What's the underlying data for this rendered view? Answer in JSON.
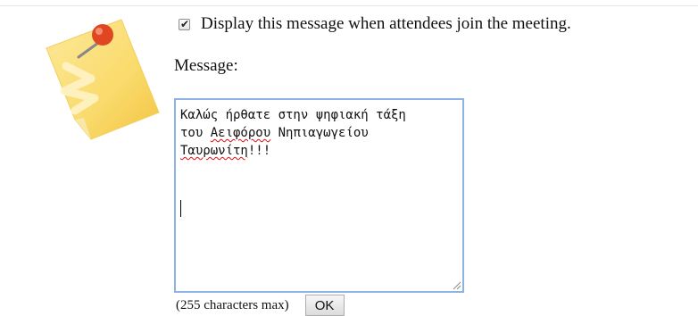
{
  "options": {
    "display_on_join": {
      "checked": true,
      "label": "Display this message when attendees join the meeting."
    }
  },
  "message": {
    "label": "Message:",
    "lines": [
      "Καλώς ήρθατε στην ψηφιακή τάξη",
      "του ",
      "Αειφόρου",
      " Νηπιαγωγείου",
      "Ταυρωνίτη",
      "!!!"
    ]
  },
  "footer": {
    "char_limit_note": "(255 characters max)",
    "ok_label": "OK"
  },
  "icons": {
    "pinned_note": "pinned-note-icon",
    "resize_grip": "resize-grip-icon",
    "checkmark": "checkmark-icon"
  },
  "colors": {
    "textarea_border": "#8fb2e6",
    "note_yellow": "#fbe38a",
    "pin_red": "#e04622",
    "spellcheck": "#dd1111"
  }
}
